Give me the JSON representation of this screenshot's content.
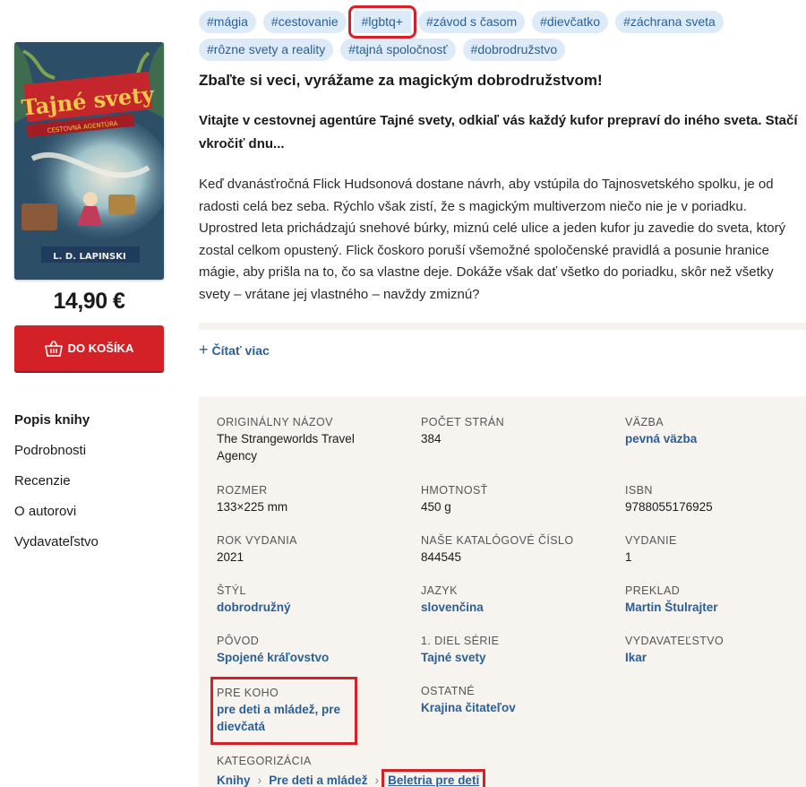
{
  "product": {
    "cover": {
      "title": "Tajné svety",
      "subtitle": "CESTOVNÁ AGENTÚRA",
      "author": "L. D. LAPINSKI"
    },
    "price": "14,90 €",
    "cart_button": "DO KOŠÍKA"
  },
  "side_nav": [
    "Popis knihy",
    "Podrobnosti",
    "Recenzie",
    "O autorovi",
    "Vydavateľstvo"
  ],
  "tags": [
    "#mágia",
    "#cestovanie",
    "#lgbtq+",
    "#závod s časom",
    "#dievčatko",
    "#záchrana sveta",
    "#rôzne svety a reality",
    "#tajná spoločnosť",
    "#dobrodružstvo"
  ],
  "description": {
    "headline": "Zbaľte si veci, vyrážame za magickým dobrodružstvom!",
    "lead": "Vitajte v cestovnej agentúre Tajné svety, odkiaľ vás každý kufor prepraví do iného sveta. Stačí vkročiť dnu...",
    "body": "Keď dvanásťročná Flick Hudsonová dostane návrh, aby vstúpila do Tajnosvetského spolku, je od radosti celá bez seba. Rýchlo však zistí, že s magickým multiverzom niečo nie je v poriadku. Uprostred leta prichádzajú snehové búrky, miznú celé ulice a jeden kufor ju zavedie do sveta, ktorý zostal celkom opustený. Flick čoskoro poruší všemožné spoločenské pravidlá a posunie hranice mágie, aby prišla na to, čo sa vlastne deje. Dokáže však dať všetko do poriadku, skôr než všetky svety – vrátane jej vlastného – navždy zmiznú?",
    "read_more": "Čítať viac"
  },
  "details": {
    "original_title": {
      "label": "ORIGINÁLNY NÁZOV",
      "value": "The Strangeworlds Travel Agency"
    },
    "pages": {
      "label": "POČET STRÁN",
      "value": "384"
    },
    "binding": {
      "label": "VÄZBA",
      "value": "pevná väzba"
    },
    "size": {
      "label": "ROZMER",
      "value": "133×225 mm"
    },
    "weight": {
      "label": "HMOTNOSŤ",
      "value": "450 g"
    },
    "isbn": {
      "label": "ISBN",
      "value": "9788055176925"
    },
    "year": {
      "label": "ROK VYDANIA",
      "value": "2021"
    },
    "catalog": {
      "label": "NAŠE KATALÓGOVÉ ČÍSLO",
      "value": "844545"
    },
    "edition": {
      "label": "VYDANIE",
      "value": "1"
    },
    "style": {
      "label": "ŠTÝL",
      "value": "dobrodružný"
    },
    "language": {
      "label": "JAZYK",
      "value": "slovenčina"
    },
    "translation": {
      "label": "PREKLAD",
      "value": "Martin Štulrajter"
    },
    "origin": {
      "label": "PÔVOD",
      "value": "Spojené kráľovstvo"
    },
    "series": {
      "label": "1. DIEL SÉRIE",
      "value": "Tajné svety"
    },
    "publisher": {
      "label": "VYDAVATEĽSTVO",
      "value": "Ikar"
    },
    "audience": {
      "label": "PRE KOHO",
      "value": "pre deti a mládež, pre dievčatá"
    },
    "other": {
      "label": "OSTATNÉ",
      "value": "Krajina čitateľov"
    },
    "categorization": {
      "label": "KATEGORIZÁCIA",
      "crumbs": [
        "Knihy",
        "Pre deti a mládež",
        "Beletria pre deti"
      ]
    }
  },
  "colors": {
    "accent": "#d42128",
    "link": "#2a5f96",
    "tag_bg": "#dcebf7",
    "panel_bg": "#f7f3ef"
  }
}
